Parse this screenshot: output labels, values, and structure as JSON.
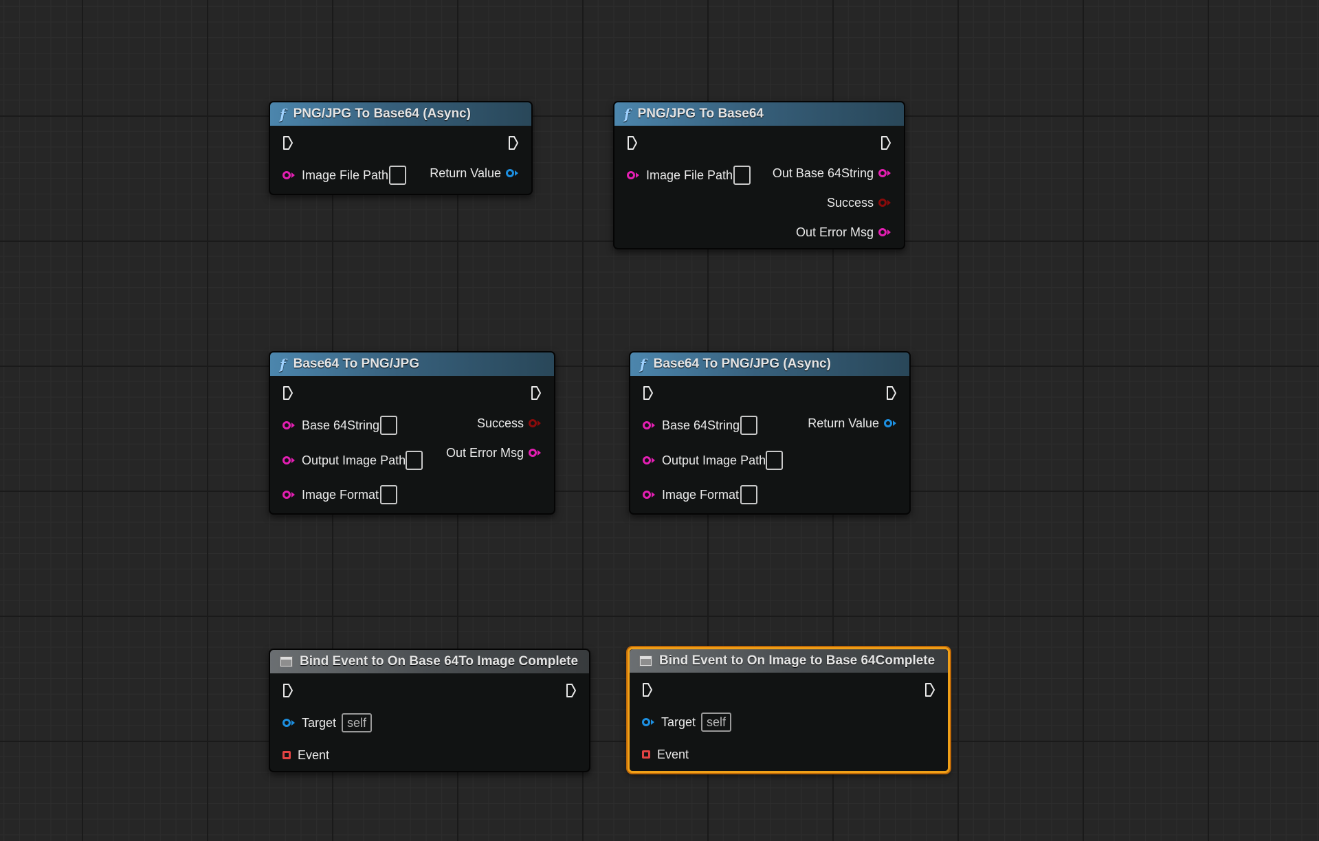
{
  "nodes": {
    "png_to_base64_async": {
      "title": "PNG/JPG To Base64 (Async)",
      "inputs": [
        "Image File Path"
      ],
      "outputs": [
        "Return Value"
      ]
    },
    "png_to_base64": {
      "title": "PNG/JPG To Base64",
      "inputs": [
        "Image File Path"
      ],
      "outputs": [
        "Out Base 64String",
        "Success",
        "Out Error Msg"
      ]
    },
    "base64_to_png": {
      "title": "Base64 To PNG/JPG",
      "inputs": [
        "Base 64String",
        "Output Image Path",
        "Image Format"
      ],
      "outputs": [
        "Success",
        "Out Error Msg"
      ]
    },
    "base64_to_png_async": {
      "title": "Base64 To PNG/JPG (Async)",
      "inputs": [
        "Base 64String",
        "Output Image Path",
        "Image Format"
      ],
      "outputs": [
        "Return Value"
      ]
    },
    "bind_base64_to_image": {
      "title": "Bind Event to On Base 64To Image Complete",
      "target_label": "Target",
      "target_default": "self",
      "event_label": "Event"
    },
    "bind_image_to_base64": {
      "title": "Bind Event to On Image to Base 64Complete",
      "target_label": "Target",
      "target_default": "self",
      "event_label": "Event",
      "selected": true
    }
  },
  "colors": {
    "string_pin": "#e41fb3",
    "object_pin": "#1d8fe0",
    "bool_pin": "#8a0b0b",
    "delegate_pin": "#e34343",
    "selection": "#f0a018",
    "function_header": "#4c86ad",
    "event_header": "#6b6f72"
  },
  "icons": {
    "function": "function-icon",
    "event": "event-icon",
    "exec": "exec-pin-icon"
  }
}
